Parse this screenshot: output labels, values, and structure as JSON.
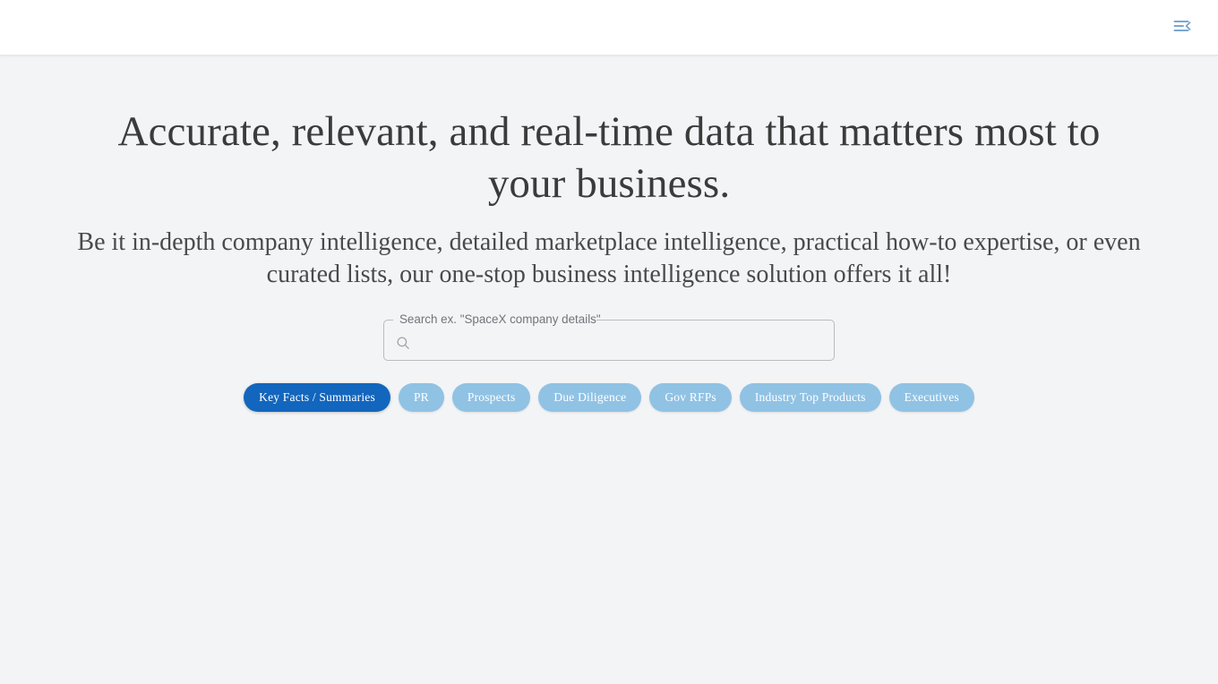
{
  "app_bar": {
    "menu_icon": "menu-fold-icon",
    "menu_label": "Toggle navigation menu"
  },
  "hero": {
    "headline": "Accurate, relevant, and real-time data that matters most to your business.",
    "subheadline": "Be it in-depth company intelligence, detailed marketplace intelligence, practical how-to expertise, or even curated lists, our one-stop business intelligence solution offers it all!"
  },
  "search": {
    "label": "Search ex. \"SpaceX company details\"",
    "value": "",
    "placeholder": "",
    "icon": "search-icon"
  },
  "categories": {
    "selected_index": 0,
    "items": [
      {
        "label": "Key Facts / Summaries",
        "selected": true
      },
      {
        "label": "PR",
        "selected": false
      },
      {
        "label": "Prospects",
        "selected": false
      },
      {
        "label": "Due Diligence",
        "selected": false
      },
      {
        "label": "Gov RFPs",
        "selected": false
      },
      {
        "label": "Industry Top Products",
        "selected": false
      },
      {
        "label": "Executives",
        "selected": false
      }
    ]
  },
  "colors": {
    "page_background": "#f3f4f6",
    "app_bar_background": "#ffffff",
    "chip_selected": "#1366bd",
    "chip_default": "#90c2e4",
    "accent_icon": "#7aa7cf",
    "text_primary": "#3b3b3b",
    "field_border": "#b9bcc0"
  }
}
